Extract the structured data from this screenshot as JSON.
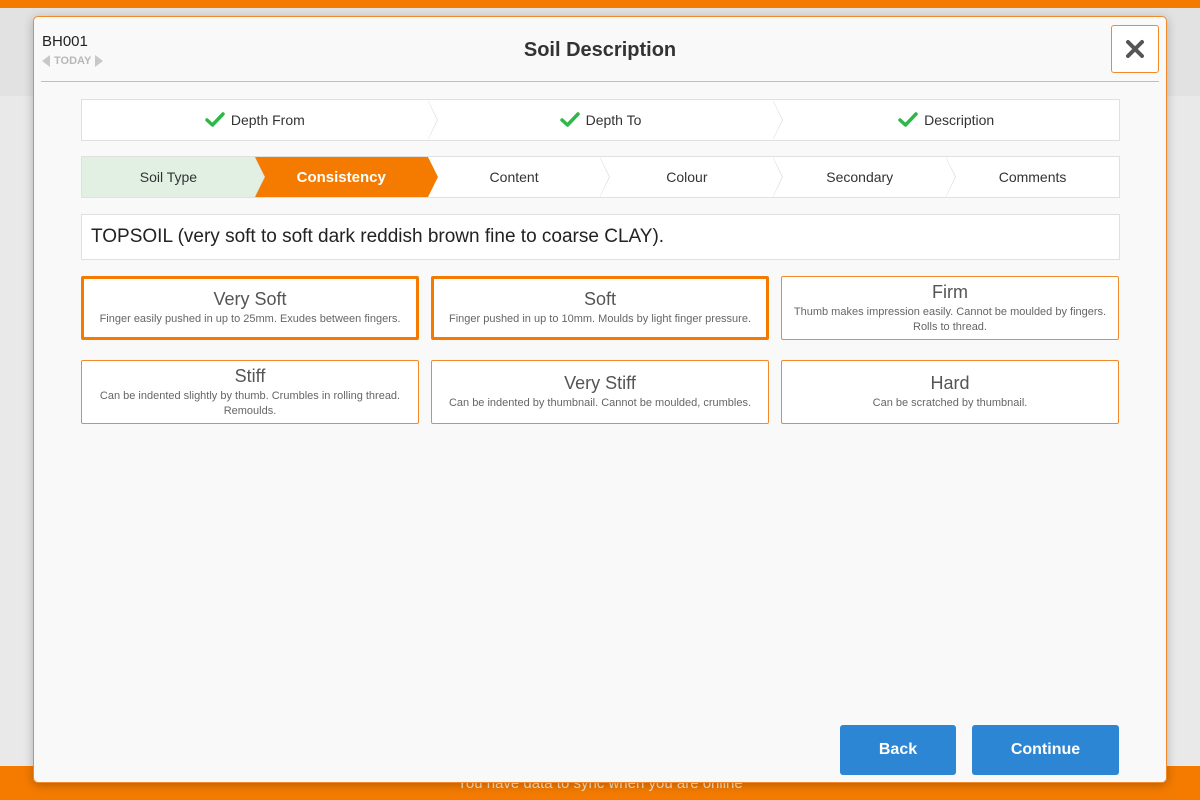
{
  "footer": {
    "sync_message": "You have data to sync when you are online"
  },
  "header": {
    "borehole_id": "BH001",
    "date_label": "TODAY",
    "title": "Soil Description",
    "close_icon": "close-icon"
  },
  "progress_steps": [
    {
      "label": "Depth From",
      "status": "complete"
    },
    {
      "label": "Depth To",
      "status": "complete"
    },
    {
      "label": "Description",
      "status": "complete"
    }
  ],
  "tabs": [
    {
      "label": "Soil Type",
      "state": "done"
    },
    {
      "label": "Consistency",
      "state": "active"
    },
    {
      "label": "Content",
      "state": "pending"
    },
    {
      "label": "Colour",
      "state": "pending"
    },
    {
      "label": "Secondary",
      "state": "pending"
    },
    {
      "label": "Comments",
      "state": "pending"
    }
  ],
  "description": "TOPSOIL (very soft to soft dark reddish brown fine to coarse CLAY).",
  "options": [
    {
      "label": "Very Soft",
      "description": "Finger easily pushed in up to 25mm. Exudes between fingers.",
      "selected": true
    },
    {
      "label": "Soft",
      "description": "Finger pushed in up to 10mm. Moulds by light finger pressure.",
      "selected": true
    },
    {
      "label": "Firm",
      "description": "Thumb makes impression easily. Cannot be moulded by fingers. Rolls to thread.",
      "selected": false
    },
    {
      "label": "Stiff",
      "description": "Can be indented slightly by thumb. Crumbles in rolling thread. Remoulds.",
      "selected": false
    },
    {
      "label": "Very Stiff",
      "description": "Can be indented by thumbnail. Cannot be moulded, crumbles.",
      "selected": false
    },
    {
      "label": "Hard",
      "description": "Can be scratched by thumbnail.",
      "selected": false
    }
  ],
  "buttons": {
    "back": "Back",
    "continue": "Continue"
  },
  "colors": {
    "accent": "#f47b00",
    "primary_button": "#2d86d4",
    "check": "#2eb84a",
    "done_tab": "#e1f0e2"
  }
}
